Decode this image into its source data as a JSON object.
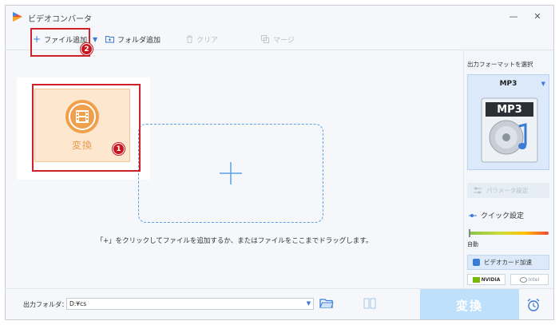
{
  "app": {
    "title": "ビデオコンバータ",
    "window_controls": {
      "minimize": "—",
      "close": "✕"
    }
  },
  "toolbar": {
    "add_file": "ファイル追加",
    "add_folder": "フォルダ追加",
    "clear": "クリア",
    "merge": "マージ"
  },
  "main": {
    "convert_label": "変換",
    "drop_hint": "「+」をクリックしてファイルを追加するか、またはファイルをここまでドラッグします。"
  },
  "annotations": {
    "marker_1": "1",
    "marker_2": "2"
  },
  "sidebar": {
    "title": "出力フォーマットを選択",
    "format": "MP3",
    "format_badge": "MP3",
    "param_settings": "パラメータ設定",
    "quick_settings": "クイック設定",
    "auto_label": "自動",
    "gpu_accel": "ビデオカード加速",
    "nvidia": "NVIDIA",
    "intel": "Intel"
  },
  "bottom": {
    "output_folder_label": "出力フォルダ：",
    "output_path": "D:¥cs",
    "convert_button": "変換"
  },
  "colors": {
    "accent": "#3a7bd5",
    "convert_orange": "#f0a04b",
    "annotation_red": "#d0202a",
    "big_button": "#bfe0fb"
  }
}
